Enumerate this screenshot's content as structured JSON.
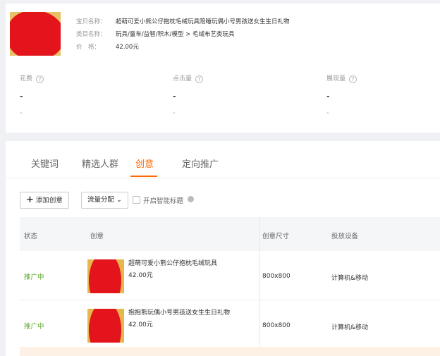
{
  "product": {
    "title_label": "宝贝名称：",
    "title_value": "超萌可爱小熊公仔抱枕毛绒玩具陪睡玩偶小号男孩送女生生日礼物",
    "category_label": "类目名称：",
    "category_value": "玩具/童车/益智/积木/模型 > 毛绒布艺类玩具",
    "price_label": "价　格：",
    "price_value": "42.00元"
  },
  "stats": [
    {
      "label": "花费",
      "value": "-",
      "sub": "-"
    },
    {
      "label": "点击量",
      "value": "-",
      "sub": "-"
    },
    {
      "label": "展现量",
      "value": "-",
      "sub": "-"
    }
  ],
  "tabs": [
    {
      "label": "关键词"
    },
    {
      "label": "精选人群"
    },
    {
      "label": "创意"
    },
    {
      "label": "定向推广"
    }
  ],
  "toolbar": {
    "add_button": "添加创意",
    "traffic_dropdown": "流量分配",
    "smart_title_label": "开启智能标题"
  },
  "table": {
    "headers": [
      "状态",
      "创意",
      "创意尺寸",
      "投放设备"
    ],
    "rows": [
      {
        "status": "推广中",
        "title": "超萌可爱小熊公仔抱枕毛绒玩具",
        "price": "42.00元",
        "size": "800x800",
        "device": "计算机&移动"
      },
      {
        "status": "推广中",
        "title": "抱抱熊玩偶小号男孩送女生生日礼物",
        "price": "42.00元",
        "size": "800x800",
        "device": "计算机&移动"
      }
    ]
  },
  "colors": {
    "accent": "#ff6a00",
    "status_active": "#5aa728",
    "background": "#f0f1f5"
  }
}
